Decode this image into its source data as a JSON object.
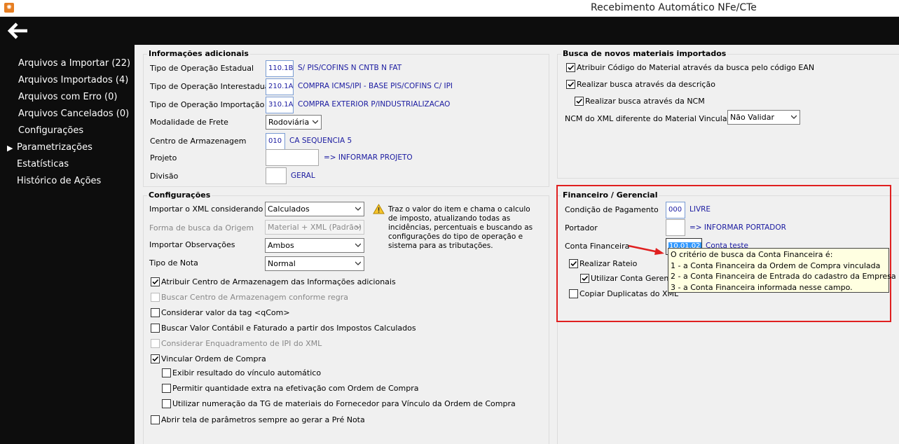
{
  "window": {
    "title": "Recebimento Automático NFe/CTe",
    "app_icon": "app-icon"
  },
  "nav": {
    "items": [
      "Arquivos a Importar (22)",
      "Arquivos Importados (4)",
      "Arquivos com Erro (0)",
      "Arquivos Cancelados (0)",
      "Configurações",
      "Parametrizações",
      "Estatísticas",
      "Histórico de Ações"
    ],
    "active_index": 5
  },
  "info": {
    "title": "Informações adicionais",
    "tipo_estadual": {
      "label": "Tipo de Operação Estadual",
      "code": "110.1B",
      "desc": "S/ PIS/COFINS N CNTB N FAT"
    },
    "tipo_interestadual": {
      "label": "Tipo de Operação Interestadual",
      "code": "210.1A",
      "desc": "COMPRA ICMS/IPI - BASE PIS/COFINS C/ IPI"
    },
    "tipo_importacao": {
      "label": "Tipo de Operação Importação",
      "code": "310.1A",
      "desc": "COMPRA EXTERIOR  P/INDUSTRIALIZACAO"
    },
    "modalidade_frete": {
      "label": "Modalidade de Frete",
      "value": "Rodoviária"
    },
    "centro_armazenagem": {
      "label": "Centro de Armazenagem",
      "code": "010",
      "desc": "CA SEQUENCIA 5"
    },
    "projeto": {
      "label": "Projeto",
      "desc": "=> INFORMAR PROJETO"
    },
    "divisao": {
      "label": "Divisão",
      "desc": "GERAL"
    }
  },
  "config": {
    "title": "Configurações",
    "importar_xml": {
      "label": "Importar o XML considerando",
      "value": "Calculados"
    },
    "forma_busca": {
      "label": "Forma de busca da Origem",
      "value": "Material + XML (Padrão)"
    },
    "importar_obs": {
      "label": "Importar Observações",
      "value": "Ambos"
    },
    "tipo_nota": {
      "label": "Tipo de Nota",
      "value": "Normal"
    },
    "warning_note": "Traz o valor do item e chama o calculo de imposto, atualizando todas as incidências, percentuais e buscando as configurações do tipo de operação e sistema para as tributações.",
    "checks": [
      {
        "label": "Atribuir Centro de Armazenagem das Informações adicionais",
        "checked": true,
        "enabled": true
      },
      {
        "label": "Buscar Centro de Armazenagem conforme regra",
        "checked": false,
        "enabled": false
      },
      {
        "label": "Considerar valor da tag <qCom>",
        "checked": false,
        "enabled": true
      },
      {
        "label": "Buscar Valor Contábil e Faturado a partir dos Impostos Calculados",
        "checked": false,
        "enabled": true
      },
      {
        "label": "Considerar Enquadramento de IPI do XML",
        "checked": false,
        "enabled": false
      },
      {
        "label": "Vincular Ordem de Compra",
        "checked": true,
        "enabled": true
      },
      {
        "label": "Exibir resultado do vínculo automático",
        "checked": false,
        "enabled": true
      },
      {
        "label": "Permitir quantidade extra na efetivação com Ordem de Compra",
        "checked": false,
        "enabled": true
      },
      {
        "label": "Utilizar numeração da TG de materiais do Fornecedor para Vínculo da Ordem de Compra",
        "checked": false,
        "enabled": true
      },
      {
        "label": "Abrir tela de parâmetros sempre ao gerar a Pré Nota",
        "checked": false,
        "enabled": true
      }
    ]
  },
  "busca": {
    "title": "Busca de novos materiais importados",
    "checks": [
      {
        "label": "Atribuir Código do Material através da busca pelo código EAN",
        "checked": true
      },
      {
        "label": "Realizar busca através da descrição",
        "checked": true
      },
      {
        "label": "Realizar busca através da NCM",
        "checked": true
      }
    ],
    "ncm": {
      "label": "NCM do XML diferente do Material Vinculado",
      "value": "Não Validar"
    }
  },
  "fin": {
    "title": "Financeiro / Gerencial",
    "condicao": {
      "label": "Condição de Pagamento",
      "code": "000",
      "desc": "LIVRE"
    },
    "portador": {
      "label": "Portador",
      "desc": "=> INFORMAR PORTADOR"
    },
    "conta": {
      "label": "Conta Financeira",
      "code": "10.01.02",
      "desc": "Conta teste"
    },
    "checks": [
      {
        "label": "Realizar Rateio",
        "checked": true
      },
      {
        "label": "Utilizar Conta Gerencial",
        "checked": true
      },
      {
        "label": "Copiar Duplicatas do XML",
        "checked": false
      }
    ]
  },
  "tooltip": {
    "lines": [
      "O critério de busca da Conta Financeira é:",
      "1 - a Conta Financeira da Ordem de Compra vinculada",
      "2 - a Conta Financeira de Entrada do cadastro da Empresa",
      "3 - a Conta Financeira informada nesse campo."
    ]
  },
  "colors": {
    "highlight_border": "#e02020",
    "arrow": "#e02020",
    "code_text": "#1a1aa0",
    "sidebar_bg": "#0d0d0d"
  }
}
